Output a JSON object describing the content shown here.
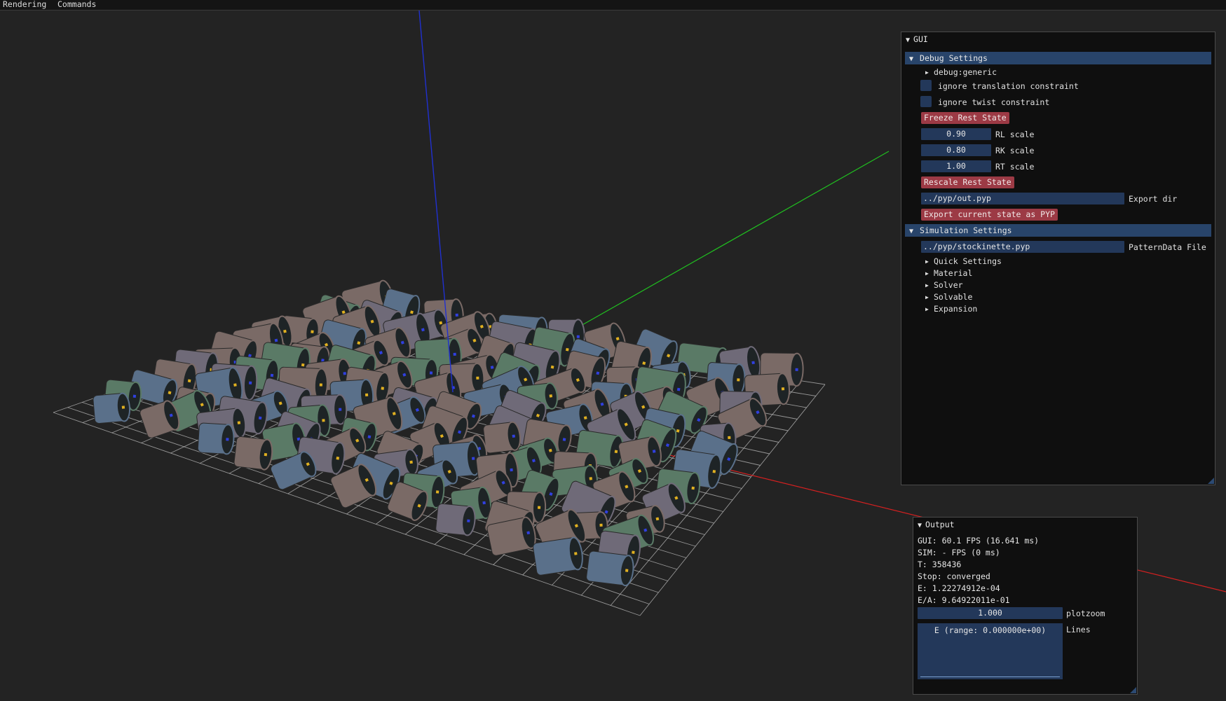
{
  "menubar": {
    "items": [
      "Rendering",
      "Commands"
    ]
  },
  "gui_window": {
    "title": "GUI",
    "debug": {
      "header": "Debug Settings",
      "generic_node": "debug:generic",
      "ignore_translation": "ignore translation constraint",
      "ignore_twist": "ignore twist constraint",
      "freeze_button": "Freeze Rest State",
      "rl_value": "0.90",
      "rl_label": "RL scale",
      "rk_value": "0.80",
      "rk_label": "RK scale",
      "rt_value": "1.00",
      "rt_label": "RT scale",
      "rescale_button": "Rescale Rest State",
      "export_dir_value": "../pyp/out.pyp",
      "export_dir_label": "Export dir",
      "export_button": "Export current state as PYP"
    },
    "simulation": {
      "header": "Simulation Settings",
      "pattern_value": "../pyp/stockinette.pyp",
      "pattern_label": "PatternData File",
      "nodes": [
        "Quick Settings",
        "Material",
        "Solver",
        "Solvable",
        "Expansion"
      ]
    }
  },
  "output_window": {
    "title": "Output",
    "lines": [
      "GUI: 60.1 FPS (16.641 ms)",
      "SIM: - FPS (0 ms)",
      "T: 358436",
      "Stop: converged",
      "E: 1.22274912e-04",
      "E/A: 9.64922011e-01"
    ],
    "plotzoom_value": "1.000",
    "plotzoom_label": "plotzoom",
    "plot_title": "E (range: 0.000000e+00)",
    "plot_label": "Lines"
  },
  "colors": {
    "axis_x": "#d42020",
    "axis_y": "#20c020",
    "axis_z": "#2030d0",
    "yarn_brown": "#7a6a66",
    "yarn_green": "#5a7a66",
    "yarn_blue": "#5a708a",
    "button": "#9c3a45",
    "header": "#28446a",
    "field": "#23385a"
  }
}
